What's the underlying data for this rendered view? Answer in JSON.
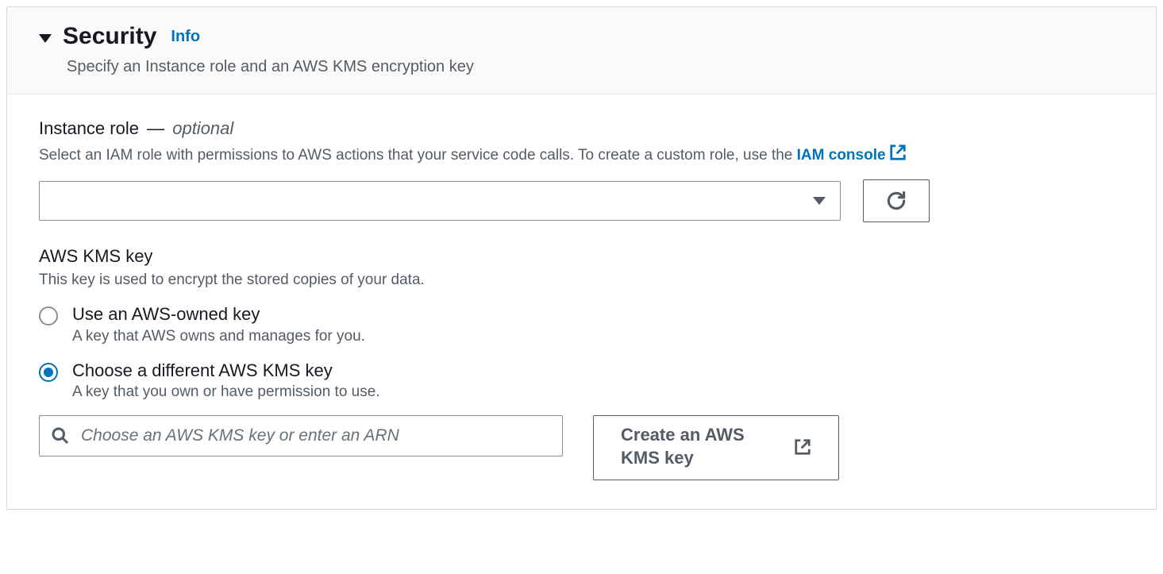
{
  "panel": {
    "title": "Security",
    "info_label": "Info",
    "subtitle": "Specify an Instance role and an AWS KMS encryption key"
  },
  "instance_role": {
    "label": "Instance role",
    "dash": "—",
    "optional": "optional",
    "description_prefix": "Select an IAM role with permissions to AWS actions that your service code calls. To create a custom role, use the ",
    "link_text": "IAM console",
    "select_value": ""
  },
  "kms": {
    "label": "AWS KMS key",
    "description": "This key is used to encrypt the stored copies of your data.",
    "options": [
      {
        "title": "Use an AWS-owned key",
        "desc": "A key that AWS owns and manages for you.",
        "selected": false
      },
      {
        "title": "Choose a different AWS KMS key",
        "desc": "A key that you own or have permission to use.",
        "selected": true
      }
    ],
    "search_placeholder": "Choose an AWS KMS key or enter an ARN",
    "create_button": "Create an AWS KMS key"
  }
}
